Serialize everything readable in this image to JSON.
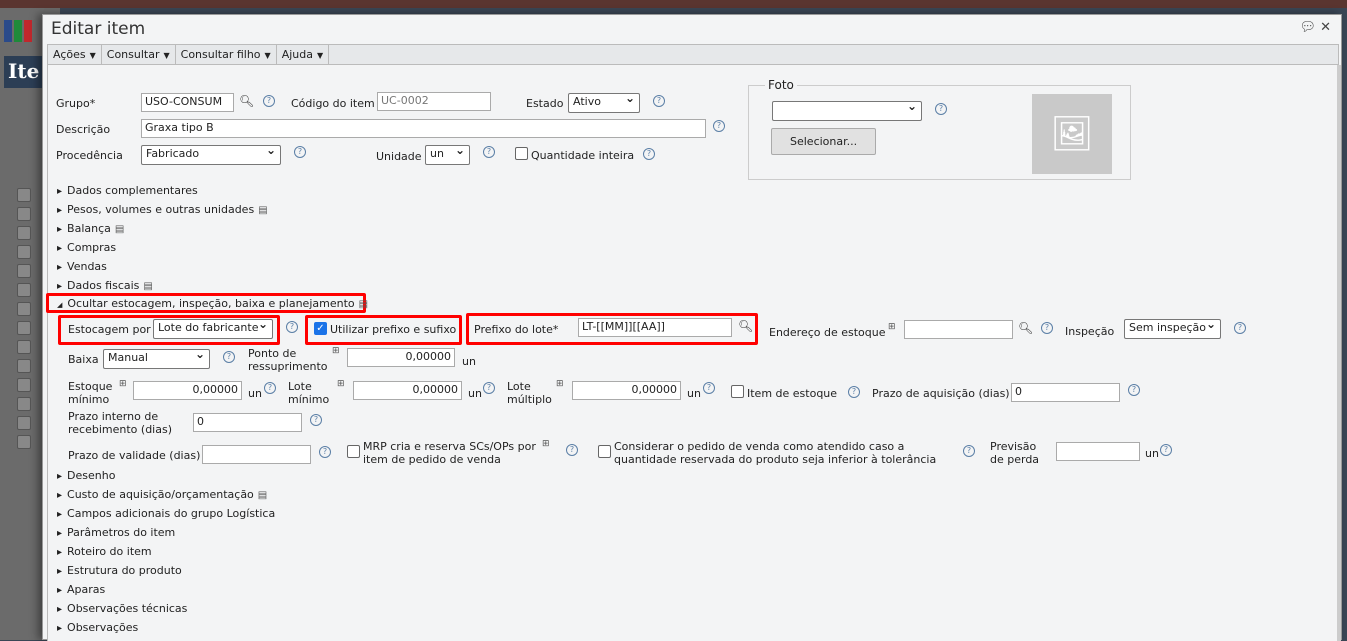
{
  "background": {
    "title": "Ite",
    "rows": 14
  },
  "dialog": {
    "title": "Editar item",
    "icons": [
      "chat-icon",
      "close-icon"
    ]
  },
  "menu": [
    "Ações",
    "Consultar",
    "Consultar filho",
    "Ajuda"
  ],
  "form": {
    "grupo_label": "Grupo*",
    "grupo": "USO-CONSUM",
    "codigo_label": "Código do item",
    "codigo": "UC-0002",
    "estado_label": "Estado",
    "estado": "Ativo",
    "descricao_label": "Descrição",
    "descricao": "Graxa tipo B",
    "procedencia_label": "Procedência",
    "procedencia": "Fabricado",
    "unidade_label": "Unidade",
    "unidade": "un",
    "qtd_inteira_label": "Quantidade inteira",
    "foto_label": "Foto",
    "foto_select": "",
    "selecionar": "Selecionar..."
  },
  "sections_top": [
    "Dados complementares",
    "Pesos, volumes e outras unidades",
    "Balança",
    "Compras",
    "Vendas",
    "Dados fiscais"
  ],
  "open_section": "Ocultar estocagem, inspeção, baixa e planejamento",
  "estoque": {
    "estocagem_label": "Estocagem por",
    "estocagem": "Lote do fabricante",
    "prefixo_sufixo_label": "Utilizar prefixo e sufixo",
    "prefixo_sufixo_checked": true,
    "prefixo_label": "Prefixo do lote*",
    "prefixo": "LT-[[MM]][[AA]]",
    "endereco_label": "Endereço de estoque",
    "endereco": "",
    "inspecao_label": "Inspeção",
    "inspecao": "Sem inspeção",
    "baixa_label": "Baixa",
    "baixa": "Manual",
    "ponto_label_1": "Ponto de",
    "ponto_label_2": "ressuprimento",
    "ponto": "0,00000",
    "est_min_label_1": "Estoque",
    "est_min_label_2": "mínimo",
    "est_min": "0,00000",
    "lote_min_label_1": "Lote",
    "lote_min_label_2": "mínimo",
    "lote_min": "0,00000",
    "lote_mult_label_1": "Lote",
    "lote_mult_label_2": "múltiplo",
    "lote_mult": "0,00000",
    "item_estoque_label": "Item de estoque",
    "prazo_aq_label": "Prazo de aquisição (dias)",
    "prazo_aq": "0",
    "prazo_int_label_1": "Prazo interno de",
    "prazo_int_label_2": "recebimento (dias)",
    "prazo_int": "0",
    "prazo_val_label": "Prazo de validade (dias)",
    "prazo_val": "",
    "mrp_label_1": "MRP cria e reserva SCs/OPs por",
    "mrp_label_2": "item de pedido de venda",
    "considerar_label_1": "Considerar o pedido de venda como atendido caso a",
    "considerar_label_2": "quantidade reservada do produto seja inferior à tolerância",
    "perda_label_1": "Previsão",
    "perda_label_2": "de perda",
    "perda": "",
    "unit": "un"
  },
  "sections_bottom": [
    "Desenho",
    "Custo de aquisição/orçamentação",
    "Campos adicionais do grupo Logística",
    "Parâmetros do item",
    "Roteiro do item",
    "Estrutura do produto",
    "Aparas",
    "Observações técnicas",
    "Observações"
  ]
}
